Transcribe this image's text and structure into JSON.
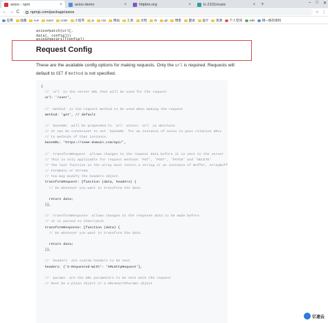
{
  "browser": {
    "tabs": [
      {
        "label": "axios - npm",
        "color": "#cb3837",
        "active": true
      },
      {
        "label": "axios-demo",
        "color": "#4a90d9",
        "active": false
      },
      {
        "label": "httpbin.org",
        "color": "#7e57c2",
        "active": false
      },
      {
        "label": "lc-2101music",
        "color": "#26a69a",
        "active": false
      }
    ],
    "new_tab": "+",
    "window_controls": [
      "–",
      "□",
      "✕"
    ],
    "url": "npmjs.com/package/axios",
    "nav": {
      "back": "←",
      "forward": "→",
      "reload": "C"
    },
    "right_icons": [
      "☆",
      "⋮"
    ]
  },
  "bookmarks": [
    {
      "label": "应用",
      "icon": "blue"
    },
    {
      "label": "收藏",
      "icon": "yellow"
    },
    {
      "label": "vue",
      "icon": "yellow"
    },
    {
      "label": "react",
      "icon": "yellow"
    },
    {
      "label": "node",
      "icon": "yellow"
    },
    {
      "label": "小程序",
      "icon": "yellow"
    },
    {
      "label": "js",
      "icon": "yellow"
    },
    {
      "label": "css",
      "icon": "yellow"
    },
    {
      "label": "网站",
      "icon": "yellow"
    },
    {
      "label": "工具",
      "icon": "yellow"
    },
    {
      "label": "文档",
      "icon": "yellow"
    },
    {
      "label": "rb",
      "icon": "yellow"
    },
    {
      "label": "git",
      "icon": "yellow"
    },
    {
      "label": "博客",
      "icon": "yellow"
    },
    {
      "label": "面试",
      "icon": "yellow"
    },
    {
      "label": "设计",
      "icon": "yellow"
    },
    {
      "label": "资源",
      "icon": "yellow"
    },
    {
      "label": "个人空间",
      "icon": "red"
    },
    {
      "label": "wiki",
      "icon": "green"
    },
    {
      "label": "杨一帆的资料",
      "icon": "blue"
    }
  ],
  "page": {
    "prototype_line1": "axios#patch(url[, data[, config]])",
    "prototype_line2": "axios#getUri([config])",
    "section_title": "Request Config",
    "desc_part1": "These are the available config options for making requests. Only the ",
    "desc_code1": "url",
    "desc_part2": " is required. Requests will default to ",
    "desc_code2": "GET",
    "desc_part3": " if ",
    "desc_code3": "method",
    "desc_part4": " is not specified."
  },
  "code_lines": [
    {
      "text": "{",
      "kind": "plain"
    },
    {
      "text": "  // `url` is the server URL that will be used for the request",
      "kind": "comment"
    },
    {
      "text": "  url: '/user',",
      "kind": "plain"
    },
    {
      "text": "",
      "kind": "plain"
    },
    {
      "text": "  // `method` is the request method to be used when making the request",
      "kind": "comment"
    },
    {
      "text": "  method: 'get', // default",
      "kind": "plain"
    },
    {
      "text": "",
      "kind": "plain"
    },
    {
      "text": "  // `baseURL` will be prepended to `url` unless `url` is absolute.",
      "kind": "comment"
    },
    {
      "text": "  // It can be convenient to set `baseURL` for an instance of axios to pass relative URLs",
      "kind": "comment"
    },
    {
      "text": "  // to methods of that instance.",
      "kind": "comment"
    },
    {
      "text": "  baseURL: 'https://some-domain.com/api/',",
      "kind": "plain"
    },
    {
      "text": "",
      "kind": "plain"
    },
    {
      "text": "  // `transformRequest` allows changes to the request data before it is sent to the server",
      "kind": "comment"
    },
    {
      "text": "  // This is only applicable for request methods 'PUT', 'POST', 'PATCH' and 'DELETE'",
      "kind": "comment"
    },
    {
      "text": "  // The last function in the array must return a string or an instance of Buffer, ArrayBuffer,",
      "kind": "comment"
    },
    {
      "text": "  // FormData or Stream",
      "kind": "comment"
    },
    {
      "text": "  // You may modify the headers object.",
      "kind": "comment"
    },
    {
      "text": "  transformRequest: [function (data, headers) {",
      "kind": "plain"
    },
    {
      "text": "    // Do whatever you want to transform the data",
      "kind": "comment"
    },
    {
      "text": "",
      "kind": "plain"
    },
    {
      "text": "    return data;",
      "kind": "plain"
    },
    {
      "text": "  }],",
      "kind": "plain"
    },
    {
      "text": "",
      "kind": "plain"
    },
    {
      "text": "  // `transformResponse` allows changes to the response data to be made before",
      "kind": "comment"
    },
    {
      "text": "  // it is passed to then/catch",
      "kind": "comment"
    },
    {
      "text": "  transformResponse: [function (data) {",
      "kind": "plain"
    },
    {
      "text": "    // Do whatever you want to transform the data",
      "kind": "comment"
    },
    {
      "text": "",
      "kind": "plain"
    },
    {
      "text": "    return data;",
      "kind": "plain"
    },
    {
      "text": "  }],",
      "kind": "plain"
    },
    {
      "text": "",
      "kind": "plain"
    },
    {
      "text": "  // `headers` are custom headers to be sent",
      "kind": "comment"
    },
    {
      "text": "  headers: {'X-Requested-With': 'XMLHttpRequest'},",
      "kind": "plain"
    },
    {
      "text": "",
      "kind": "plain"
    },
    {
      "text": "  // `params` are the URL parameters to be sent with the request",
      "kind": "comment"
    },
    {
      "text": "  // Must be a plain object or a URLSearchParams object",
      "kind": "comment"
    }
  ],
  "watermark": {
    "text": "亿速云",
    "icon": "yisu-logo-icon"
  },
  "colors": {
    "highlight_border": "#d34a4a",
    "code_bg": "#f6f8fa",
    "comment": "#8a929a"
  }
}
